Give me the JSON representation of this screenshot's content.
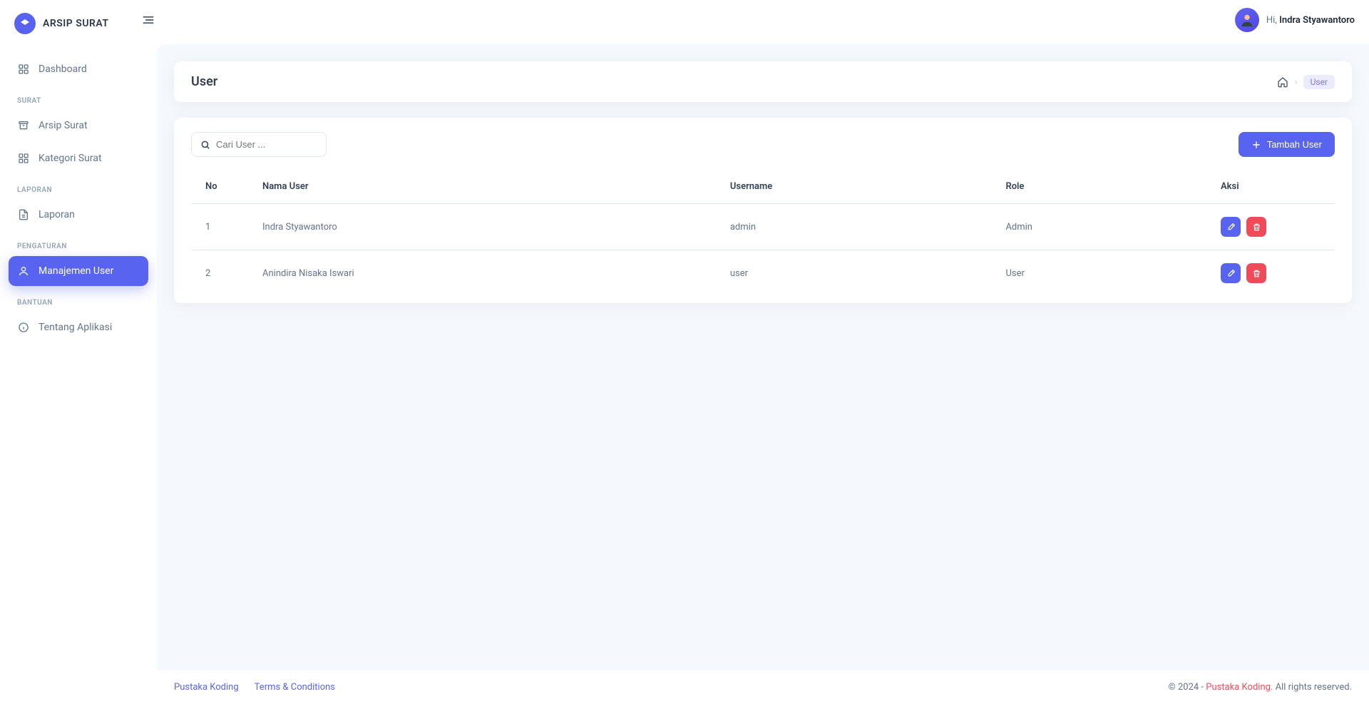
{
  "brand": {
    "name": "ARSIP SURAT"
  },
  "header": {
    "greeting_prefix": "Hi,",
    "user_name": "Indra Styawantoro"
  },
  "sidebar": {
    "items": [
      {
        "label": "Dashboard"
      }
    ],
    "sections": [
      {
        "title": "SURAT",
        "items": [
          {
            "label": "Arsip Surat"
          },
          {
            "label": "Kategori Surat"
          }
        ]
      },
      {
        "title": "LAPORAN",
        "items": [
          {
            "label": "Laporan"
          }
        ]
      },
      {
        "title": "PENGATURAN",
        "items": [
          {
            "label": "Manajemen User",
            "active": true
          }
        ]
      },
      {
        "title": "BANTUAN",
        "items": [
          {
            "label": "Tentang Aplikasi"
          }
        ]
      }
    ]
  },
  "page": {
    "title": "User",
    "breadcrumb_current": "User",
    "search_placeholder": "Cari User ...",
    "add_button_label": "Tambah User"
  },
  "table": {
    "columns": [
      "No",
      "Nama User",
      "Username",
      "Role",
      "Aksi"
    ],
    "rows": [
      {
        "no": "1",
        "nama": "Indra Styawantoro",
        "username": "admin",
        "role": "Admin"
      },
      {
        "no": "2",
        "nama": "Anindira Nisaka Iswari",
        "username": "user",
        "role": "User"
      }
    ]
  },
  "footer": {
    "link1": "Pustaka Koding",
    "link2": "Terms & Conditions",
    "copyright_prefix": "© 2024 - ",
    "brand": "Pustaka Koding.",
    "copyright_suffix": " All rights reserved."
  }
}
